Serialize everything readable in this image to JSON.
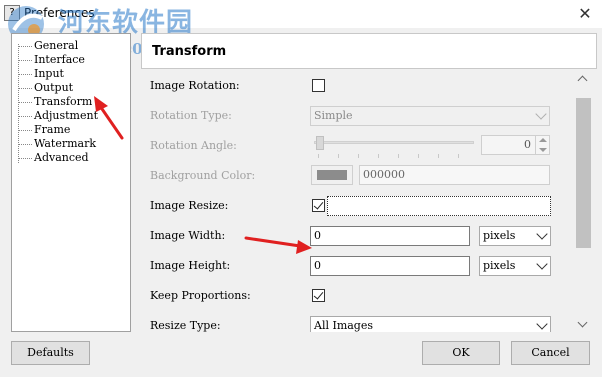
{
  "window": {
    "title": "Preferences",
    "close_glyph": "✕",
    "icon_glyph": "?"
  },
  "watermark": {
    "line1": "河东软件园",
    "line2": "www.pc0359.cn"
  },
  "tree": {
    "items": [
      {
        "label": "General"
      },
      {
        "label": "Interface"
      },
      {
        "label": "Input"
      },
      {
        "label": "Output"
      },
      {
        "label": "Transform"
      },
      {
        "label": "Adjustment"
      },
      {
        "label": "Frame"
      },
      {
        "label": "Watermark"
      },
      {
        "label": "Advanced"
      }
    ],
    "selected": "Transform"
  },
  "page": {
    "title": "Transform",
    "image_rotation": {
      "label": "Image Rotation:",
      "checked": false
    },
    "rotation_type": {
      "label": "Rotation Type:",
      "value": "Simple",
      "disabled": true
    },
    "rotation_angle": {
      "label": "Rotation Angle:",
      "value": "0",
      "disabled": true
    },
    "background_color": {
      "label": "Background Color:",
      "value": "000000",
      "swatch": "#8c8c8c",
      "disabled": true
    },
    "image_resize": {
      "label": "Image Resize:",
      "checked": true
    },
    "image_width": {
      "label": "Image Width:",
      "value": "0",
      "unit": "pixels"
    },
    "image_height": {
      "label": "Image Height:",
      "value": "0",
      "unit": "pixels"
    },
    "keep_proportions": {
      "label": "Keep Proportions:",
      "checked": true
    },
    "resize_type": {
      "label": "Resize Type:",
      "value": "All Images"
    }
  },
  "buttons": {
    "defaults": "Defaults",
    "ok": "OK",
    "cancel": "Cancel"
  },
  "colors": {
    "annotation_arrow": "#e02020",
    "watermark": "#2878c8"
  }
}
